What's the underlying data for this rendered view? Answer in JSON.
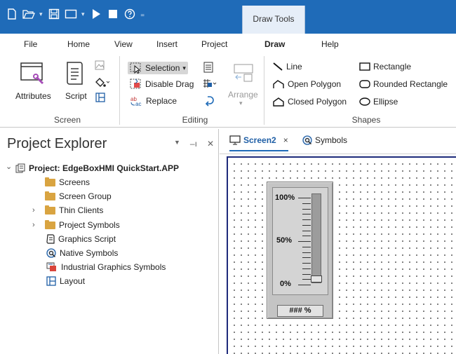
{
  "contextual_tab": {
    "label": "Draw Tools"
  },
  "ribbon_tabs": [
    {
      "label": "File"
    },
    {
      "label": "Home"
    },
    {
      "label": "View"
    },
    {
      "label": "Insert"
    },
    {
      "label": "Project"
    },
    {
      "label": "Draw",
      "active": true
    },
    {
      "label": "Help"
    }
  ],
  "ribbon": {
    "screen": {
      "label": "Screen",
      "attributes": "Attributes",
      "script": "Script"
    },
    "editing": {
      "label": "Editing",
      "selection": "Selection",
      "disable_drag": "Disable Drag",
      "replace": "Replace",
      "arrange": "Arrange"
    },
    "shapes": {
      "label": "Shapes",
      "line": "Line",
      "open_polygon": "Open Polygon",
      "closed_polygon": "Closed Polygon",
      "rectangle": "Rectangle",
      "rounded_rectangle": "Rounded Rectangle",
      "ellipse": "Ellipse"
    }
  },
  "explorer": {
    "title": "Project Explorer",
    "pin_glyph": "–ı",
    "root": "Project: EdgeBoxHMI QuickStart.APP",
    "items": [
      {
        "label": "Screens"
      },
      {
        "label": "Screen Group"
      },
      {
        "label": "Thin Clients"
      },
      {
        "label": "Project Symbols"
      },
      {
        "label": "Graphics Script"
      },
      {
        "label": "Native Symbols"
      },
      {
        "label": "Industrial Graphics Symbols"
      },
      {
        "label": "Layout"
      }
    ]
  },
  "doc_tabs": [
    {
      "label": "Screen2",
      "close": "×"
    },
    {
      "label": "Symbols"
    }
  ],
  "gauge": {
    "label_top": "100%",
    "label_mid": "50%",
    "label_bottom": "0%",
    "readout": "### %"
  },
  "colors": {
    "title_bar": "#1f6bb8",
    "accent": "#1f6bb8",
    "canvas_border": "#1d2a7a",
    "folder": "#d9a441"
  }
}
